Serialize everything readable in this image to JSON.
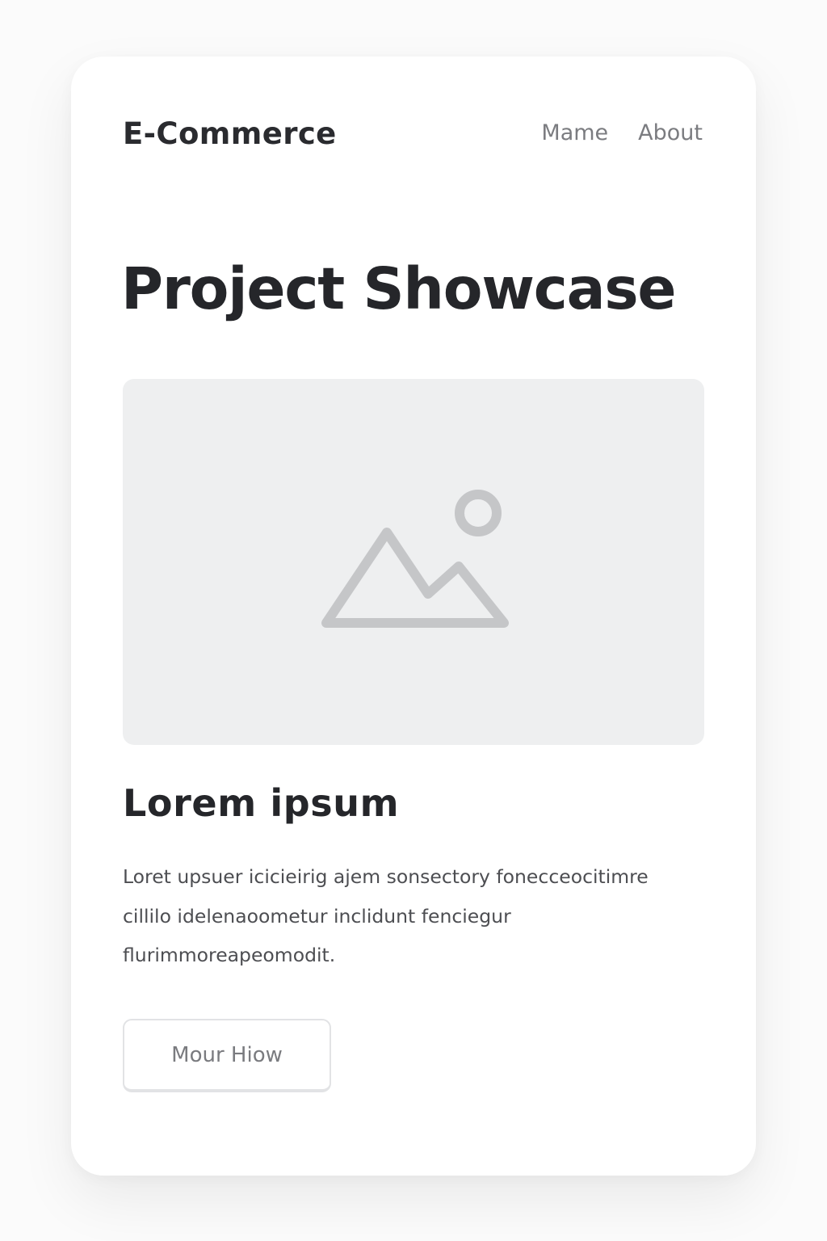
{
  "header": {
    "brand": "E-Commerce",
    "nav": [
      {
        "label": "Mame"
      },
      {
        "label": "About"
      }
    ]
  },
  "main": {
    "title": "Project Showcase",
    "image_placeholder": {
      "icon": "image-icon",
      "background": "#eeeff0",
      "icon_color": "#c5c6c8"
    },
    "card": {
      "heading": "Lorem ipsum",
      "description": "Loret upsuer icicieirig ajem sonsectory fonecceocitimre cillilo idelenaoometur inclidunt fenciegur flurimmoreapeomodit.",
      "button_label": "Mour Hiow"
    }
  },
  "colors": {
    "text_primary": "#25262a",
    "text_secondary": "#7b7c80",
    "card_background": "#ffffff",
    "page_background": "#fbfbfb"
  }
}
